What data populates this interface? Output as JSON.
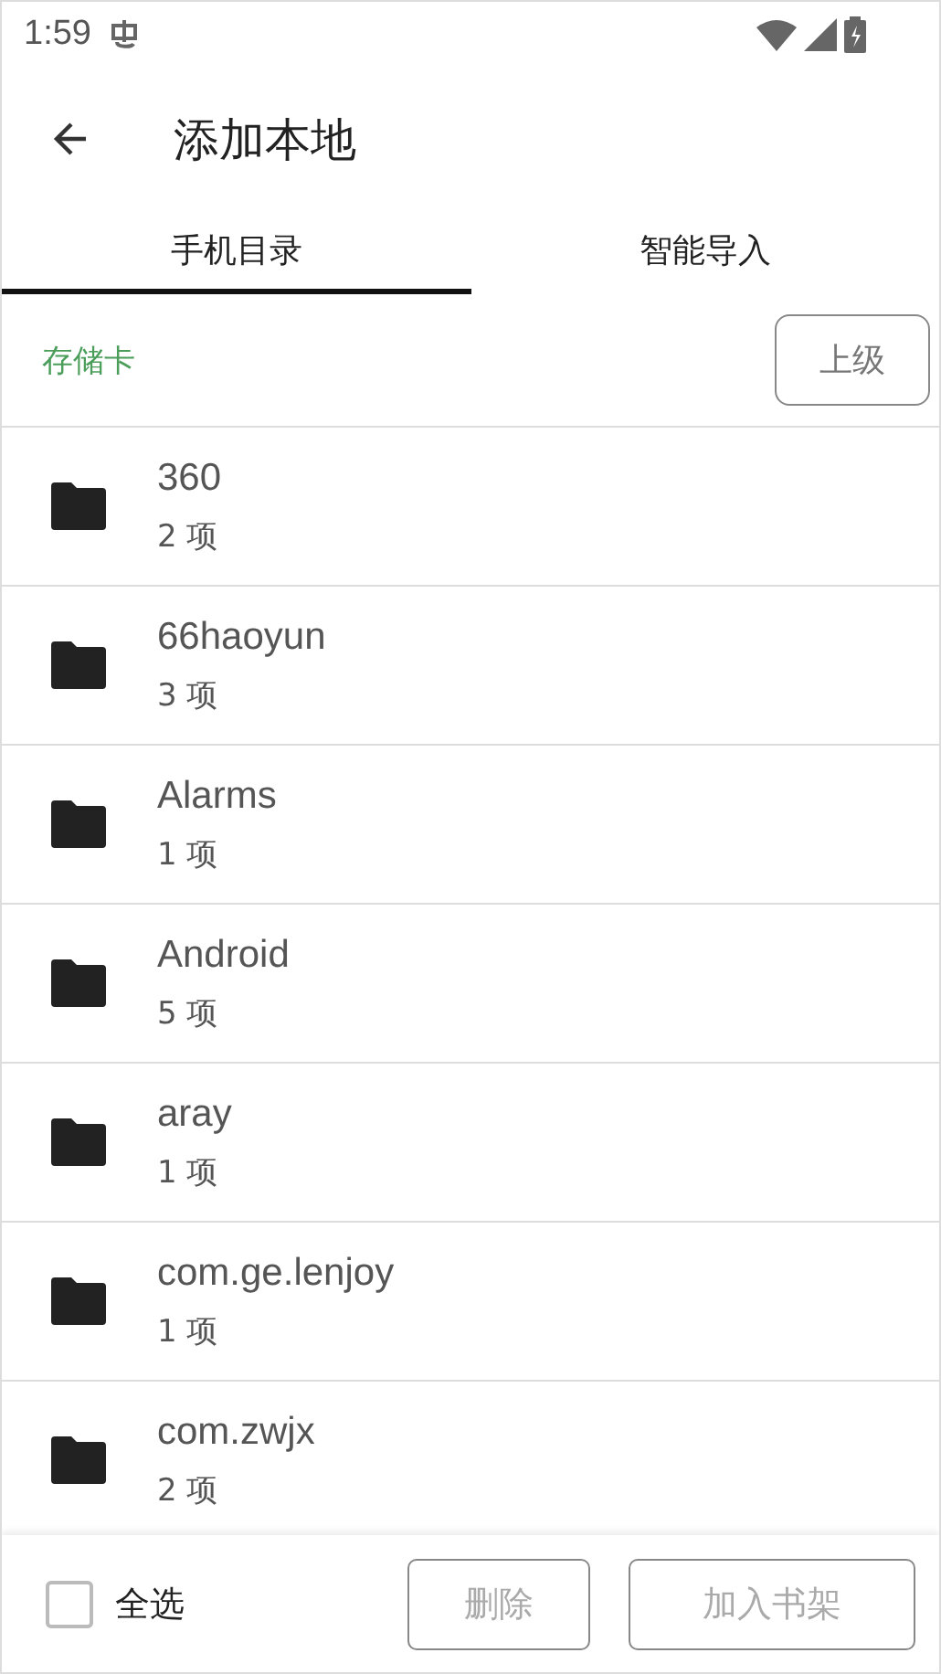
{
  "status_bar": {
    "time": "1:59"
  },
  "toolbar": {
    "title": "添加本地"
  },
  "tabs": [
    {
      "label": "手机目录",
      "selected": true
    },
    {
      "label": "智能导入",
      "selected": false
    }
  ],
  "path": {
    "label": "存储卡",
    "up_button": "上级"
  },
  "folders": [
    {
      "name": "360",
      "count": "2 项"
    },
    {
      "name": "66haoyun",
      "count": "3 项"
    },
    {
      "name": "Alarms",
      "count": "1 项"
    },
    {
      "name": "Android",
      "count": "5 项"
    },
    {
      "name": "aray",
      "count": "1 项"
    },
    {
      "name": "com.ge.lenjoy",
      "count": "1 项"
    },
    {
      "name": "com.zwjx",
      "count": "2 项"
    }
  ],
  "bottom_bar": {
    "select_all": {
      "label": "全选",
      "checked": false
    },
    "buttons": [
      {
        "label": "删除",
        "disabled": true
      },
      {
        "label": "加入书架",
        "disabled": true
      }
    ]
  }
}
